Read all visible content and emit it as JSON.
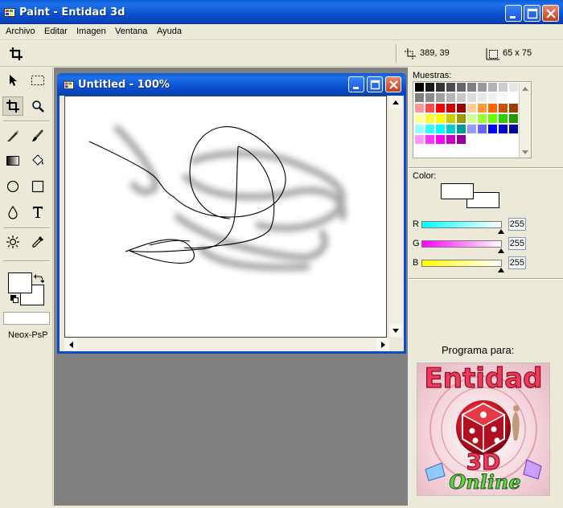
{
  "window": {
    "title": "Paint - Entidad 3d"
  },
  "menu": {
    "items": [
      "Archivo",
      "Editar",
      "Imagen",
      "Ventana",
      "Ayuda"
    ]
  },
  "toolbar": {
    "cursor_position": "389, 39",
    "selection_size": "65 x 75"
  },
  "tools": {
    "user_label": "Neox-PsP",
    "icons": [
      "pointer-icon",
      "rect-select-icon",
      "crop-icon",
      "zoom-icon",
      "pen-icon",
      "brush-icon",
      "gradient-icon",
      "fill-bucket-icon",
      "ellipse-icon",
      "rectangle-icon",
      "drop-icon",
      "text-icon",
      "brightness-icon",
      "eyedropper-icon"
    ]
  },
  "document": {
    "title": "Untitled - 100%"
  },
  "swatches": {
    "label": "Muestras:",
    "colors": [
      [
        "#000000",
        "#1a1a1a",
        "#333333",
        "#4d4d4d",
        "#666666",
        "#808080",
        "#999999",
        "#b3b3b3",
        "#cccccc",
        "#e6e6e6"
      ],
      [
        "#7f7f7f",
        "#8c8c8c",
        "#a0a0a0",
        "#b4b4b4",
        "#c8c8c8",
        "#dcdcdc",
        "#e8e8e8",
        "#f0f0f0",
        "#f8f8f8",
        "#ffffff"
      ],
      [
        "#ff9999",
        "#ff4d4d",
        "#ff0000",
        "#cc0000",
        "#990000",
        "#ffcc99",
        "#ff9933",
        "#ff6600",
        "#cc5200",
        "#994000"
      ],
      [
        "#ffff99",
        "#ffff33",
        "#ffff00",
        "#cccc00",
        "#999900",
        "#ccff99",
        "#99ff33",
        "#66ff00",
        "#33cc00",
        "#229900"
      ],
      [
        "#99ffff",
        "#33ffff",
        "#00ffff",
        "#00cccc",
        "#009999",
        "#9999ff",
        "#6666ff",
        "#0000ff",
        "#0000cc",
        "#000099"
      ],
      [
        "#ff99ff",
        "#ff33ff",
        "#ff00ff",
        "#cc00cc",
        "#990099"
      ]
    ]
  },
  "color": {
    "label": "Color:",
    "r_label": "R",
    "g_label": "G",
    "b_label": "B",
    "r": "255",
    "g": "255",
    "b": "255"
  },
  "promo": {
    "label": "Programa para:",
    "logo_text_top": "Entidad",
    "logo_text_mid": "3D",
    "logo_text_bottom": "Online"
  }
}
